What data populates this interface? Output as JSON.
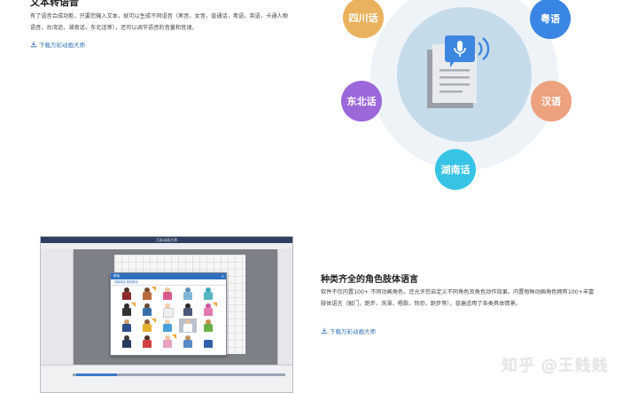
{
  "tts": {
    "title": "文本转语音",
    "description": "有了语音合成功能，只要您输入文本，就可以生成不同语音（男音，女音，普通话，粤语，英语，卡通人物语音，台湾话，湖南话，东北话等），还可以调节语音的音量和音速。",
    "download_label": "下载万彩动画大师"
  },
  "dialects": [
    {
      "label": "四川话",
      "color": "#eab25e"
    },
    {
      "label": "粤语",
      "color": "#3a86e4"
    },
    {
      "label": "东北话",
      "color": "#9b68d9"
    },
    {
      "label": "汉语",
      "color": "#eda17e"
    },
    {
      "label": "湖南话",
      "color": "#37c3e6"
    }
  ],
  "illustration": {
    "icons": [
      "document-icon",
      "microphone-icon",
      "sound-wave-icon"
    ]
  },
  "roles": {
    "title": "种类齐全的角色肢体语言",
    "description": "软件不仅内置100+ 不同动画角色，还允许您自定义不同角色及角色动作效果。内置每种动画角色拥有100+丰富肢体语言（敲门，跑步，洗澡，唱歌，惊恐，跑步等），普遍适用了各类具体情景。",
    "download_label": "下载万彩动画大师"
  },
  "screenshot": {
    "window_title": "万彩动画大师",
    "dialog_title": "角色",
    "dialog_tab": "内置角色  我的角色"
  },
  "watermark": "知乎 @王贱贱"
}
